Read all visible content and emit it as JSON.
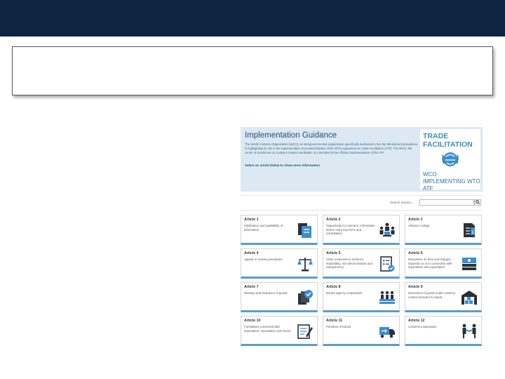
{
  "banner": {
    "title": "Implementation Guidance",
    "text": "The World Customs Organization (WCO), as intergovernmental organization specifically dedicated to the Dar Ministerial Declarations, is highlighting its role in the implementation and administration of the WTO Agreement on Trade Facilitation (ATF). The WCO, the centre of excellence on Customs matters worldwide, is committed to the efficient implementation of the ATF.",
    "link": "Select an article below to show more information"
  },
  "badge": {
    "title_line1": "TRADE",
    "title_line2": "FACILITATION",
    "subtitle": "WCO IMPLEMENTING WTO ATF"
  },
  "search": {
    "label": "Search articles...",
    "placeholder": "",
    "button_icon": "search-icon"
  },
  "articles": [
    {
      "num": "Article 1",
      "desc": "Publication and availability of information",
      "icon": "documents-icon"
    },
    {
      "num": "Article 2",
      "desc": "Opportunity to comment, information before entry into force and consultation",
      "icon": "meeting-icon"
    },
    {
      "num": "Article 3",
      "desc": "Advance rulings",
      "icon": "info-document-icon"
    },
    {
      "num": "Article 4",
      "desc": "Appeal or review procedures",
      "icon": "scales-icon"
    },
    {
      "num": "Article 5",
      "desc": "Other measures to enhance impartiality, non-discrimination and transparency",
      "icon": "checklist-icon"
    },
    {
      "num": "Article 6",
      "desc": "Disciplines on fees and charges imposed on or in connection with importation and exportation",
      "icon": "banknotes-icon"
    },
    {
      "num": "Article 7",
      "desc": "Release and clearance of goods",
      "icon": "approved-documents-icon"
    },
    {
      "num": "Article 8",
      "desc": "Border agency cooperation",
      "icon": "agency-group-icon"
    },
    {
      "num": "Article 9",
      "desc": "Movement of goods under customs control intended to import",
      "icon": "warehouse-icon"
    },
    {
      "num": "Article 10",
      "desc": "Formalities connected with importation, exportation and transit",
      "icon": "form-pen-icon"
    },
    {
      "num": "Article 11",
      "desc": "Freedom of transit",
      "icon": "truck-transit-icon"
    },
    {
      "num": "Article 12",
      "desc": "Customs cooperation",
      "icon": "handshake-icon"
    }
  ],
  "colors": {
    "top_bar": "#0f2440",
    "banner_bg": "#dce9f3",
    "heading_blue": "#1f4e79",
    "tile_accent": "#5b9bd5",
    "icon_dark": "#2b3038",
    "icon_blue": "#3b8ed0"
  }
}
